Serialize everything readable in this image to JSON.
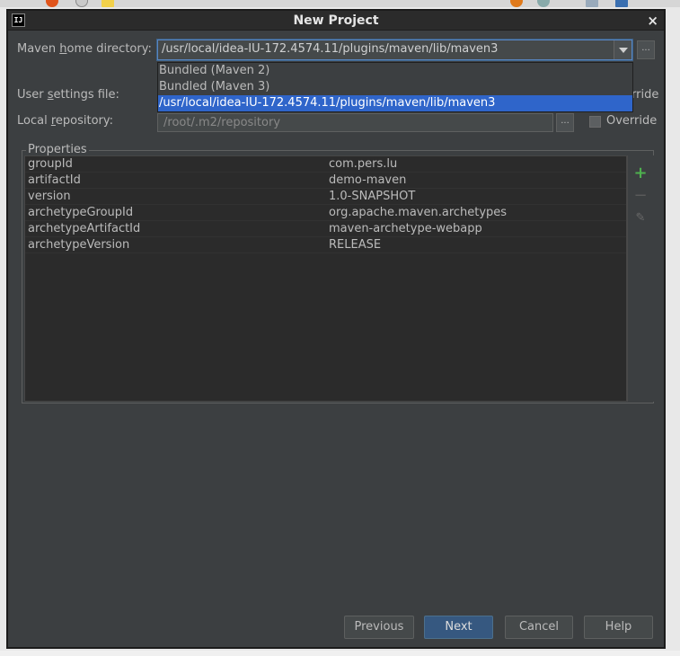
{
  "window": {
    "title": "New Project",
    "app_icon_text": "IJ",
    "close_glyph": "×"
  },
  "maven_home": {
    "label_pre": "Maven ",
    "label_mnemonic": "h",
    "label_post": "ome directory:",
    "value": "/usr/local/idea-IU-172.4574.11/plugins/maven/lib/maven3",
    "browse_label": "...",
    "options": [
      "Bundled (Maven 2)",
      "Bundled (Maven 3)",
      "/usr/local/idea-IU-172.4574.11/plugins/maven/lib/maven3"
    ],
    "selected_index": 2
  },
  "user_settings": {
    "label_pre": "User ",
    "label_mnemonic": "s",
    "label_post": "ettings file:",
    "override_label_partial": "rride"
  },
  "local_repo": {
    "label_pre": "Local ",
    "label_mnemonic": "r",
    "label_post": "epository:",
    "placeholder": "/root/.m2/repository",
    "browse_label": "...",
    "override_label": "Override"
  },
  "properties": {
    "legend": "Properties",
    "rows": [
      {
        "key": "groupId",
        "value": "com.pers.lu"
      },
      {
        "key": "artifactId",
        "value": "demo-maven"
      },
      {
        "key": "version",
        "value": "1.0-SNAPSHOT"
      },
      {
        "key": "archetypeGroupId",
        "value": "org.apache.maven.archetypes"
      },
      {
        "key": "archetypeArtifactId",
        "value": "maven-archetype-webapp"
      },
      {
        "key": "archetypeVersion",
        "value": "RELEASE"
      }
    ],
    "tools": {
      "add": "+",
      "remove": "−",
      "edit": "✎"
    }
  },
  "buttons": {
    "previous": "Previous",
    "next": "Next",
    "cancel": "Cancel",
    "help": "Help"
  },
  "colors": {
    "accent": "#2f65ca",
    "background": "#3c3f41",
    "primary_button": "#365880",
    "add_icon": "#4eb04e"
  }
}
